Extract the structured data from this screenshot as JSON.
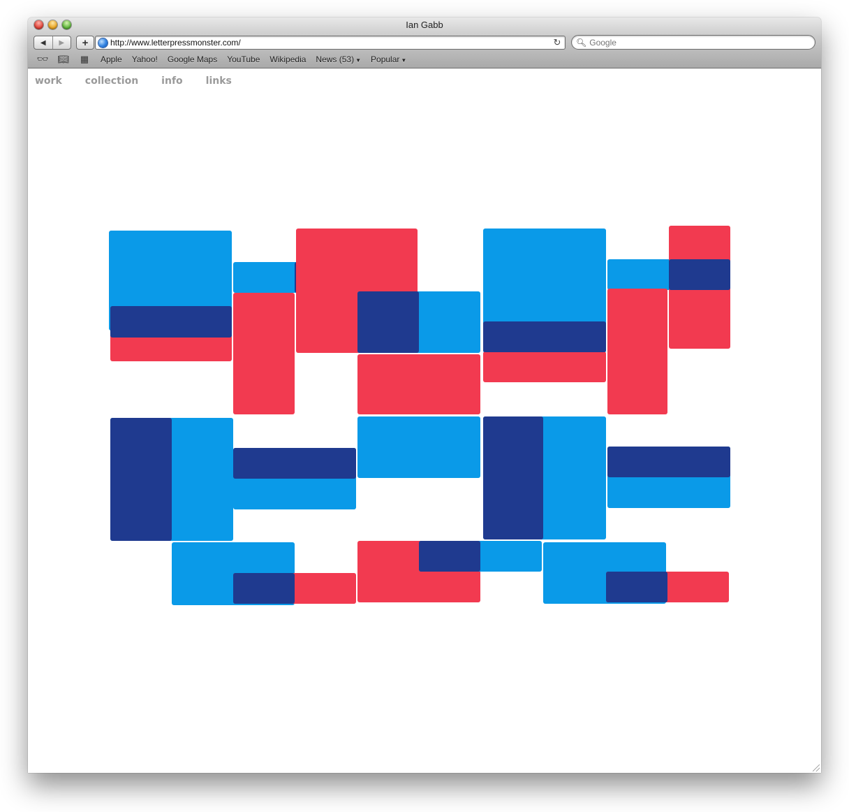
{
  "window": {
    "title": "Ian Gabb"
  },
  "toolbar": {
    "url": "http://www.letterpressmonster.com/",
    "search_placeholder": "Google"
  },
  "bookmarks": [
    {
      "label": "Apple"
    },
    {
      "label": "Yahoo!"
    },
    {
      "label": "Google Maps"
    },
    {
      "label": "YouTube"
    },
    {
      "label": "Wikipedia"
    },
    {
      "label": "News (53)",
      "menu": true
    },
    {
      "label": "Popular",
      "menu": true
    }
  ],
  "site_nav": [
    {
      "label": "work"
    },
    {
      "label": "collection"
    },
    {
      "label": "info"
    },
    {
      "label": "links"
    }
  ],
  "artwork": {
    "colors": {
      "cyan": "#0a9ae8",
      "red": "#f23a50",
      "navy": "#1f3a8f"
    }
  }
}
